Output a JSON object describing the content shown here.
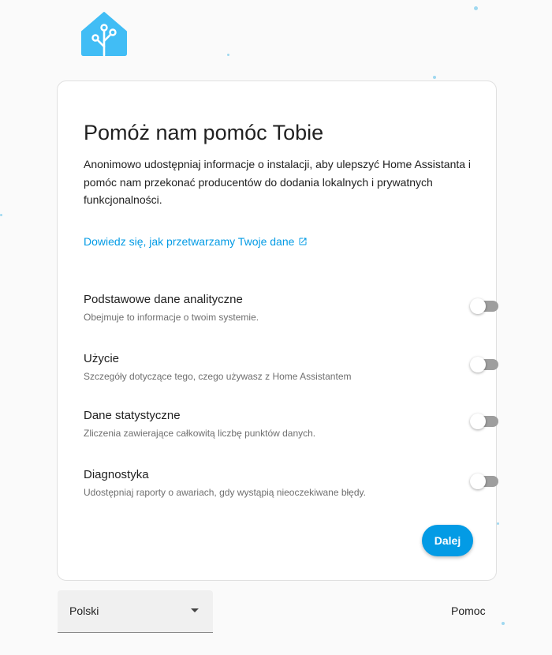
{
  "brand": {
    "logo_icon": "home-assistant-logo-icon",
    "colors": {
      "primary": "#039be5",
      "logo": "#41bdf5",
      "switch_off": "#9e9e9e"
    }
  },
  "card": {
    "title": "Pomóż nam pomóc Tobie",
    "description": "Anonimowo udostępniaj informacje o instalacji, aby ulepszyć Home Assistanta i pomóc nam przekonać producentów do dodania lokalnych i prywatnych funkcjonalności.",
    "learn_more": {
      "label": "Dowiedz się, jak przetwarzamy Twoje dane",
      "icon": "open-in-new-icon"
    },
    "options": [
      {
        "title": "Podstawowe dane analityczne",
        "description": "Obejmuje to informacje o twoim systemie.",
        "enabled": false
      },
      {
        "title": "Użycie",
        "description": "Szczegóły dotyczące tego, czego używasz z Home Assistantem",
        "enabled": false
      },
      {
        "title": "Dane statystyczne",
        "description": "Zliczenia zawierające całkowitą liczbę punktów danych.",
        "enabled": false
      },
      {
        "title": "Diagnostyka",
        "description": "Udostępniaj raporty o awariach, gdy wystąpią nieoczekiwane błędy.",
        "enabled": false
      }
    ],
    "next_button": "Dalej"
  },
  "footer": {
    "language": {
      "selected": "Polski",
      "icon": "chevron-down-icon"
    },
    "help_label": "Pomoc"
  }
}
